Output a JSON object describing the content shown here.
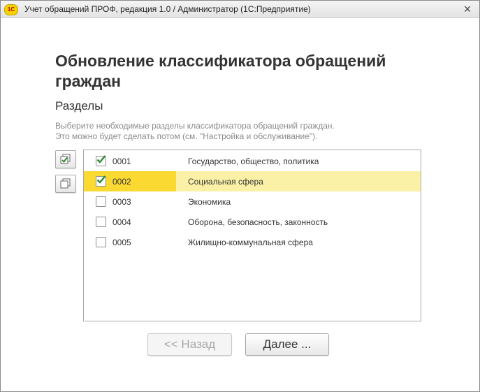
{
  "window": {
    "logo": "1С",
    "title": "Учет обращений ПРОФ, редакция 1.0 / Администратор  (1С:Предприятие)",
    "close_symbol": "×"
  },
  "page": {
    "title": "Обновление классификатора обращений граждан",
    "section": "Разделы",
    "hint_line1": "Выберите необходимые разделы классификатора обращений граждан.",
    "hint_line2": "Это можно будет сделать потом (см. \"Настройка и обслуживание\")."
  },
  "toolbar": {
    "check_all_icon": "check-all-icon",
    "uncheck_all_icon": "uncheck-all-icon"
  },
  "sections": [
    {
      "code": "0001",
      "name": "Государство, общество, политика",
      "checked": true,
      "selected": false
    },
    {
      "code": "0002",
      "name": "Социальная сфера",
      "checked": true,
      "selected": true
    },
    {
      "code": "0003",
      "name": "Экономика",
      "checked": false,
      "selected": false
    },
    {
      "code": "0004",
      "name": "Оборона, безопасность, законность",
      "checked": false,
      "selected": false
    },
    {
      "code": "0005",
      "name": "Жилищно-коммунальная сфера",
      "checked": false,
      "selected": false
    }
  ],
  "buttons": {
    "back_label": "<< Назад",
    "next_label": "Далее ..."
  },
  "colors": {
    "check_mark": "#2e8b2e",
    "selected_row": "#fbf1a6",
    "selected_cell": "#fad932"
  }
}
